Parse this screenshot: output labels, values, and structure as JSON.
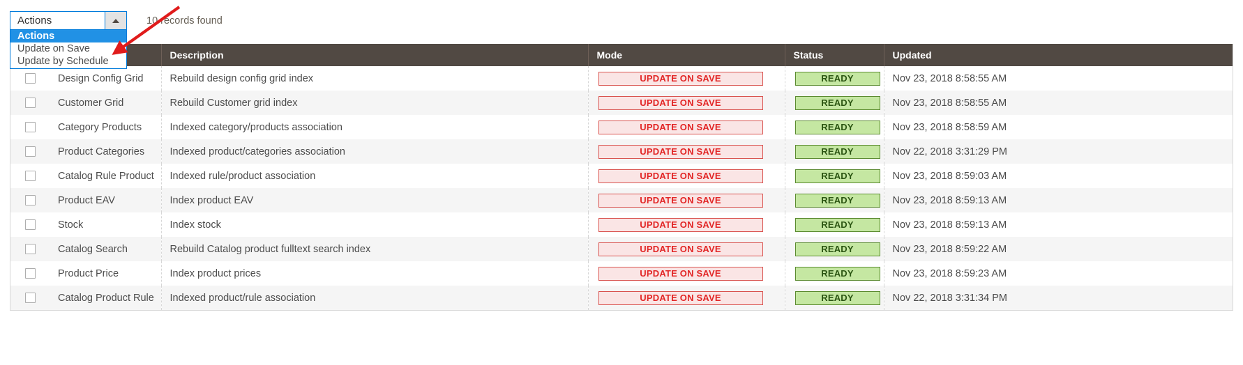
{
  "toolbar": {
    "actions_select": {
      "value": "Actions",
      "caret_icon": "caret-up-icon",
      "open": true,
      "options": [
        {
          "label": "Actions",
          "selected": true
        },
        {
          "label": "Update on Save",
          "selected": false
        },
        {
          "label": "Update by Schedule",
          "selected": false
        }
      ]
    },
    "records_found": "10 records found"
  },
  "annotation": {
    "arrow_icon": "red-arrow-icon",
    "color": "#e01b1b"
  },
  "grid": {
    "columns": [
      {
        "key": "check",
        "label": ""
      },
      {
        "key": "title",
        "label": ""
      },
      {
        "key": "description",
        "label": "Description"
      },
      {
        "key": "mode",
        "label": "Mode"
      },
      {
        "key": "status",
        "label": "Status"
      },
      {
        "key": "updated",
        "label": "Updated"
      }
    ],
    "rows": [
      {
        "title": "Design Config Grid",
        "description": "Rebuild design config grid index",
        "mode": "UPDATE ON SAVE",
        "status": "READY",
        "updated": "Nov 23, 2018 8:58:55 AM"
      },
      {
        "title": "Customer Grid",
        "description": "Rebuild Customer grid index",
        "mode": "UPDATE ON SAVE",
        "status": "READY",
        "updated": "Nov 23, 2018 8:58:55 AM"
      },
      {
        "title": "Category Products",
        "description": "Indexed category/products association",
        "mode": "UPDATE ON SAVE",
        "status": "READY",
        "updated": "Nov 23, 2018 8:58:59 AM"
      },
      {
        "title": "Product Categories",
        "description": "Indexed product/categories association",
        "mode": "UPDATE ON SAVE",
        "status": "READY",
        "updated": "Nov 22, 2018 3:31:29 PM"
      },
      {
        "title": "Catalog Rule Product",
        "description": "Indexed rule/product association",
        "mode": "UPDATE ON SAVE",
        "status": "READY",
        "updated": "Nov 23, 2018 8:59:03 AM"
      },
      {
        "title": "Product EAV",
        "description": "Index product EAV",
        "mode": "UPDATE ON SAVE",
        "status": "READY",
        "updated": "Nov 23, 2018 8:59:13 AM"
      },
      {
        "title": "Stock",
        "description": "Index stock",
        "mode": "UPDATE ON SAVE",
        "status": "READY",
        "updated": "Nov 23, 2018 8:59:13 AM"
      },
      {
        "title": "Catalog Search",
        "description": "Rebuild Catalog product fulltext search index",
        "mode": "UPDATE ON SAVE",
        "status": "READY",
        "updated": "Nov 23, 2018 8:59:22 AM"
      },
      {
        "title": "Product Price",
        "description": "Index product prices",
        "mode": "UPDATE ON SAVE",
        "status": "READY",
        "updated": "Nov 23, 2018 8:59:23 AM"
      },
      {
        "title": "Catalog Product Rule",
        "description": "Indexed product/rule association",
        "mode": "UPDATE ON SAVE",
        "status": "READY",
        "updated": "Nov 22, 2018 3:31:34 PM"
      }
    ]
  },
  "colors": {
    "header_bg": "#514943",
    "select_border": "#007bdb",
    "option_selected_bg": "#2191e5",
    "mode_badge_bg": "#fae5e5",
    "mode_badge_text": "#e22626",
    "status_badge_bg": "#c5e7a2",
    "status_badge_text": "#2b5512"
  }
}
